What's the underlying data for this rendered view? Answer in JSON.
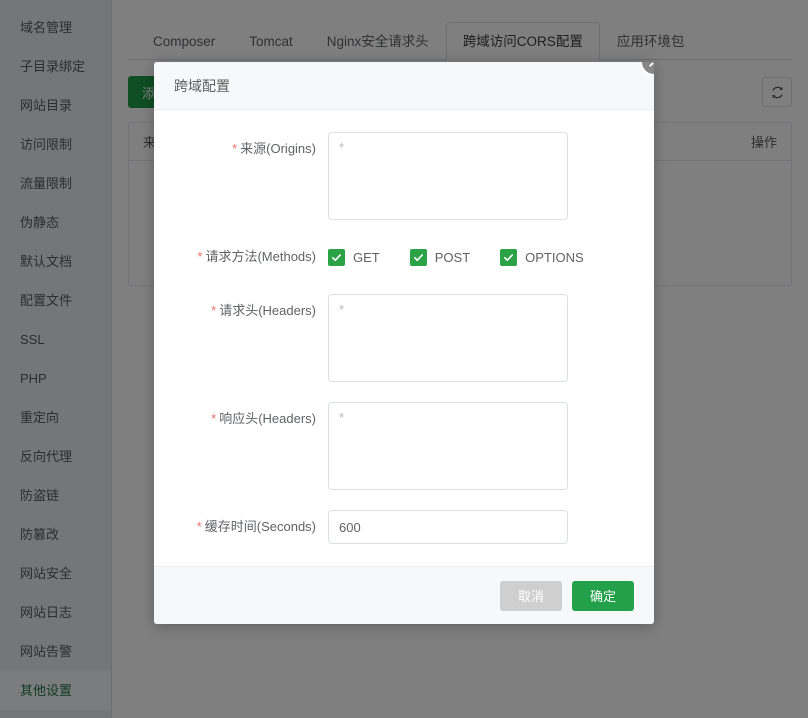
{
  "sidebar": {
    "items": [
      {
        "label": "域名管理",
        "active": false
      },
      {
        "label": "子目录绑定",
        "active": false
      },
      {
        "label": "网站目录",
        "active": false
      },
      {
        "label": "访问限制",
        "active": false
      },
      {
        "label": "流量限制",
        "active": false
      },
      {
        "label": "伪静态",
        "active": false
      },
      {
        "label": "默认文档",
        "active": false
      },
      {
        "label": "配置文件",
        "active": false
      },
      {
        "label": "SSL",
        "active": false
      },
      {
        "label": "PHP",
        "active": false
      },
      {
        "label": "重定向",
        "active": false
      },
      {
        "label": "反向代理",
        "active": false
      },
      {
        "label": "防盗链",
        "active": false
      },
      {
        "label": "防篡改",
        "active": false
      },
      {
        "label": "网站安全",
        "active": false
      },
      {
        "label": "网站日志",
        "active": false
      },
      {
        "label": "网站告警",
        "active": false
      },
      {
        "label": "其他设置",
        "active": true
      }
    ]
  },
  "tabs": [
    {
      "label": "Composer",
      "active": false
    },
    {
      "label": "Tomcat",
      "active": false
    },
    {
      "label": "Nginx安全请求头",
      "active": false
    },
    {
      "label": "跨域访问CORS配置",
      "active": true
    },
    {
      "label": "应用环境包",
      "active": false
    }
  ],
  "toolbar": {
    "add_label": "添加跨域配置",
    "refresh_icon": "refresh-icon"
  },
  "table": {
    "columns": [
      "来源(Origins)",
      "操作"
    ]
  },
  "dialog": {
    "title": "跨域配置",
    "close_icon": "close-icon",
    "fields": {
      "origins": {
        "label": "来源(Origins)",
        "required_mark": "*",
        "value": "",
        "placeholder": "*"
      },
      "methods": {
        "label": "请求方法(Methods)",
        "required_mark": "*",
        "options": [
          {
            "label": "GET",
            "checked": true
          },
          {
            "label": "POST",
            "checked": true
          },
          {
            "label": "OPTIONS",
            "checked": true
          }
        ]
      },
      "request_headers": {
        "label": "请求头(Headers)",
        "required_mark": "*",
        "value": "",
        "placeholder": "*"
      },
      "response_headers": {
        "label": "响应头(Headers)",
        "required_mark": "*",
        "value": "",
        "placeholder": "*"
      },
      "max_age": {
        "label": "缓存时间(Seconds)",
        "required_mark": "*",
        "value": "600",
        "placeholder": ""
      }
    },
    "footer": {
      "cancel_label": "取消",
      "confirm_label": "确定"
    }
  },
  "colors": {
    "accent_green": "#22a14a",
    "checkbox_green": "#2ba245",
    "required_red": "#f56c6c",
    "cancel_gray": "#cfcfcf",
    "overlay": "rgba(0,0,0,0.5)"
  }
}
